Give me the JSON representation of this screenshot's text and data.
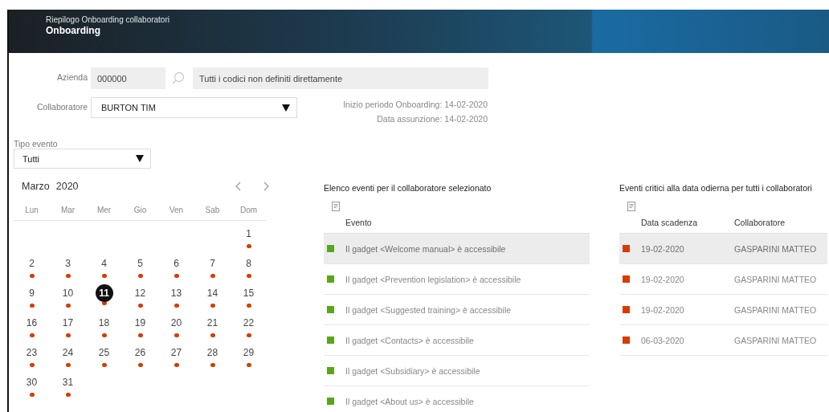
{
  "header": {
    "subtitle": "Riepilogo Onboarding collaboratori",
    "title": "Onboarding"
  },
  "form": {
    "company": {
      "label": "Azienda",
      "code": "000000",
      "description": "Tutti i codici non definiti direttamente"
    },
    "employee": {
      "label": "Collaboratore",
      "value": "BURTON TIM"
    },
    "info": [
      "Inizio periodo Onboarding: 14-02-2020",
      "Data assunzione: 14-02-2020"
    ],
    "event_type": {
      "label": "Tipo evento",
      "value": "Tutti"
    }
  },
  "calendar": {
    "month": "Marzo",
    "year": "2020",
    "weekdays": [
      "Lun",
      "Mar",
      "Mer",
      "Gio",
      "Ven",
      "Sab",
      "Dom"
    ],
    "weeks": [
      [
        {
          "day": "1",
          "event": true,
          "selected": false
        }
      ],
      [
        {
          "day": "2",
          "event": true,
          "selected": false
        },
        {
          "day": "3",
          "event": true,
          "selected": false
        },
        {
          "day": "4",
          "event": true,
          "selected": false
        },
        {
          "day": "5",
          "event": true,
          "selected": false
        },
        {
          "day": "6",
          "event": true,
          "selected": false
        },
        {
          "day": "7",
          "event": true,
          "selected": false
        },
        {
          "day": "8",
          "event": true,
          "selected": false
        }
      ],
      [
        {
          "day": "9",
          "event": true,
          "selected": false
        },
        {
          "day": "10",
          "event": true,
          "selected": false
        },
        {
          "day": "11",
          "event": true,
          "selected": true
        },
        {
          "day": "12",
          "event": true,
          "selected": false
        },
        {
          "day": "13",
          "event": true,
          "selected": false
        },
        {
          "day": "14",
          "event": true,
          "selected": false
        },
        {
          "day": "15",
          "event": true,
          "selected": false
        }
      ],
      [
        {
          "day": "16",
          "event": true,
          "selected": false
        },
        {
          "day": "17",
          "event": true,
          "selected": false
        },
        {
          "day": "18",
          "event": true,
          "selected": false
        },
        {
          "day": "19",
          "event": true,
          "selected": false
        },
        {
          "day": "20",
          "event": true,
          "selected": false
        },
        {
          "day": "21",
          "event": true,
          "selected": false
        },
        {
          "day": "22",
          "event": true,
          "selected": false
        }
      ],
      [
        {
          "day": "23",
          "event": true,
          "selected": false
        },
        {
          "day": "24",
          "event": true,
          "selected": false
        },
        {
          "day": "25",
          "event": true,
          "selected": false
        },
        {
          "day": "26",
          "event": true,
          "selected": false
        },
        {
          "day": "27",
          "event": true,
          "selected": false
        },
        {
          "day": "28",
          "event": true,
          "selected": false
        },
        {
          "day": "29",
          "event": true,
          "selected": false
        }
      ],
      [
        {
          "day": "30",
          "event": true,
          "selected": false
        },
        {
          "day": "31",
          "event": true,
          "selected": false
        }
      ]
    ]
  },
  "tables": [
    {
      "title": "Elenco eventi per il collaboratore selezionato",
      "columns": [
        "Evento"
      ],
      "rows": [
        {
          "cells": [
            "Il gadget <Welcome manual> è accessibile"
          ],
          "color": "#5aa51e",
          "selected": true
        },
        {
          "cells": [
            "Il gadget <Prevention legislation> è accessibile"
          ],
          "color": "#5aa51e",
          "selected": false
        },
        {
          "cells": [
            "Il gadget <Suggested training> è accessibile"
          ],
          "color": "#5aa51e",
          "selected": false
        },
        {
          "cells": [
            "Il gadget <Contacts> è accessibile"
          ],
          "color": "#5aa51e",
          "selected": false
        },
        {
          "cells": [
            "Il gadget <Subsidiary> è accessibile"
          ],
          "color": "#5aa51e",
          "selected": false
        },
        {
          "cells": [
            "Il gadget <About us> è accessibile"
          ],
          "color": "#5aa51e",
          "selected": false
        }
      ]
    },
    {
      "title": "Eventi critici alla data odierna per tutti i collaboratori",
      "columns": [
        "Data scadenza",
        "Collaboratore"
      ],
      "rows": [
        {
          "cells": [
            "19-02-2020",
            "GASPARINI MATTEO"
          ],
          "color": "#d83b01",
          "selected": true
        },
        {
          "cells": [
            "19-02-2020",
            "GASPARINI MATTEO"
          ],
          "color": "#d83b01",
          "selected": false
        },
        {
          "cells": [
            "19-02-2020",
            "GASPARINI MATTEO"
          ],
          "color": "#d83b01",
          "selected": false
        },
        {
          "cells": [
            "06-03-2020",
            "GASPARINI MATTEO"
          ],
          "color": "#d83b01",
          "selected": false
        }
      ]
    }
  ]
}
